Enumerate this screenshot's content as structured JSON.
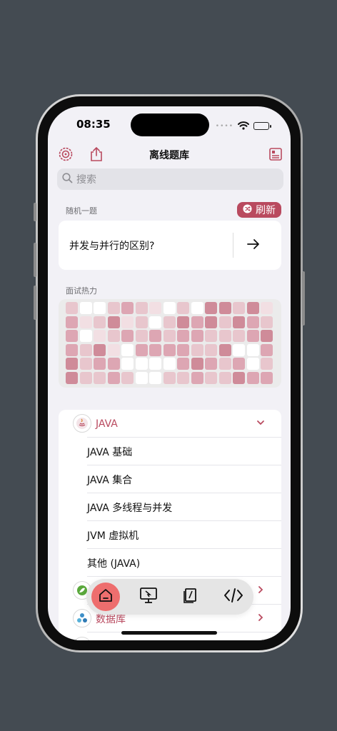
{
  "status_bar": {
    "time": "08:35",
    "signal_dots": "••••"
  },
  "nav": {
    "title": "离线题库"
  },
  "search": {
    "placeholder": "搜索"
  },
  "random": {
    "section_label": "随机一题",
    "refresh_label": "刷新",
    "question": "并发与并行的区别?"
  },
  "heatmap": {
    "section_label": "面试热力",
    "rows": [
      [
        2,
        0,
        0,
        2,
        3,
        2,
        1,
        0,
        2,
        0,
        4,
        4,
        2,
        4,
        1
      ],
      [
        3,
        1,
        2,
        4,
        1,
        2,
        0,
        2,
        4,
        3,
        4,
        2,
        4,
        3,
        2
      ],
      [
        3,
        0,
        1,
        2,
        3,
        2,
        3,
        2,
        3,
        3,
        2,
        2,
        2,
        3,
        4
      ],
      [
        3,
        2,
        4,
        1,
        0,
        3,
        3,
        3,
        3,
        2,
        2,
        4,
        0,
        0,
        3
      ],
      [
        4,
        2,
        3,
        3,
        0,
        0,
        0,
        0,
        3,
        4,
        3,
        2,
        3,
        0,
        2
      ],
      [
        4,
        2,
        2,
        3,
        2,
        0,
        0,
        2,
        2,
        3,
        2,
        2,
        4,
        3,
        3
      ]
    ],
    "palette": [
      "#ffffff",
      "#f2dfe3",
      "#e8c6cd",
      "#dda6b3",
      "#cf8b99"
    ]
  },
  "tree": {
    "groups": [
      {
        "label": "JAVA",
        "expanded": true,
        "children": [
          "JAVA 基础",
          "JAVA 集合",
          "JAVA 多线程与并发",
          "JVM 虚拟机",
          "其他 (JAVA)"
        ]
      },
      {
        "label": "",
        "expanded": false
      },
      {
        "label": "数据库",
        "expanded": false
      }
    ]
  },
  "tabs": [
    {
      "name": "home",
      "active": true
    },
    {
      "name": "interview",
      "active": false
    },
    {
      "name": "notes",
      "active": false
    },
    {
      "name": "code",
      "active": false
    }
  ],
  "colors": {
    "accent": "#b94a5f",
    "tab_active": "#ee6e6e",
    "background": "#f2f1f6"
  }
}
